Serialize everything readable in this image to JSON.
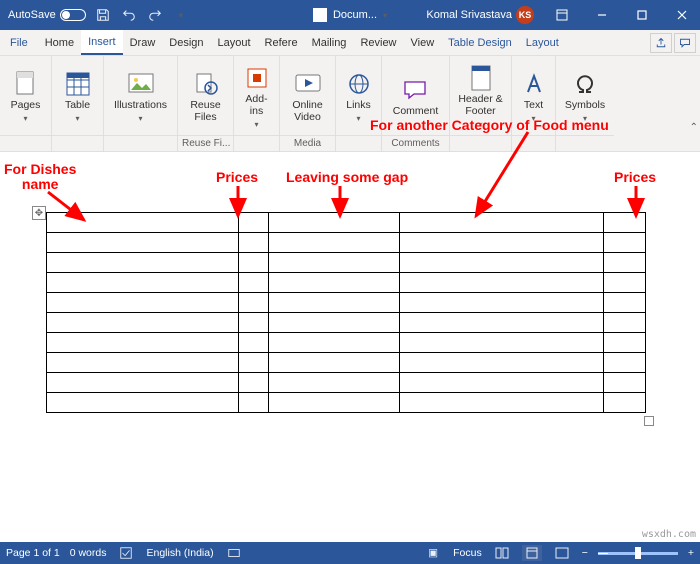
{
  "titlebar": {
    "autosave": "AutoSave",
    "doc_name": "Docum...",
    "user_name": "Komal Srivastava",
    "user_initials": "KS"
  },
  "tabs": {
    "file": "File",
    "home": "Home",
    "insert": "Insert",
    "draw": "Draw",
    "design": "Design",
    "layout": "Layout",
    "refere": "Refere",
    "mailing": "Mailing",
    "review": "Review",
    "view": "View",
    "table_design": "Table Design",
    "layout2": "Layout"
  },
  "ribbon": {
    "pages": "Pages",
    "table": "Table",
    "illustrations": "Illustrations",
    "reuse_files": "Reuse\nFiles",
    "reuse_files_group": "Reuse Fi...",
    "addins": "Add-\nins",
    "online_video": "Online\nVideo",
    "media_group": "Media",
    "links": "Links",
    "comment": "Comment",
    "comments_group": "Comments",
    "header_footer": "Header &\nFooter",
    "text": "Text",
    "symbols": "Symbols"
  },
  "annotations": {
    "dishes": "For Dishes\nname",
    "prices1": "Prices",
    "gap": "Leaving some gap",
    "category": "For another Category of Food menu",
    "prices2": "Prices"
  },
  "status": {
    "page": "Page 1 of 1",
    "words": "0 words",
    "lang": "English (India)",
    "focus": "Focus",
    "zoom_minus": "−",
    "zoom_plus": "+"
  },
  "watermark": "wsxdh.com"
}
